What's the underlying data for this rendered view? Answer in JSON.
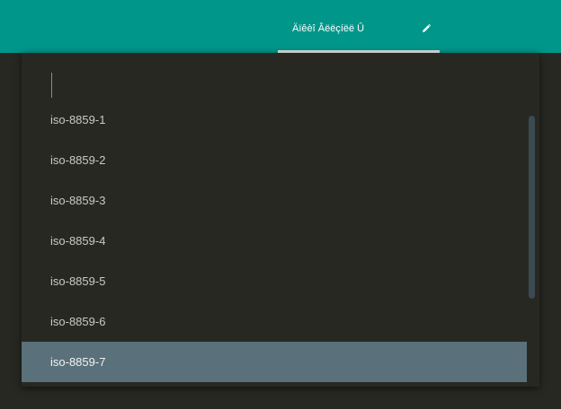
{
  "topbar": {
    "tab_label": "Äïêèî Âëëçíëë Û",
    "edit_icon": "pencil-icon",
    "accent_color": "#00968a"
  },
  "search": {
    "value": "",
    "placeholder": ""
  },
  "encodings": [
    "iso-8859-1",
    "iso-8859-2",
    "iso-8859-3",
    "iso-8859-4",
    "iso-8859-5",
    "iso-8859-6",
    "iso-8859-7"
  ],
  "selected_encoding": "iso-8859-7",
  "colors": {
    "background": "#282823",
    "selected_row": "#5a707a",
    "scrollbar": "#3b4a52"
  }
}
